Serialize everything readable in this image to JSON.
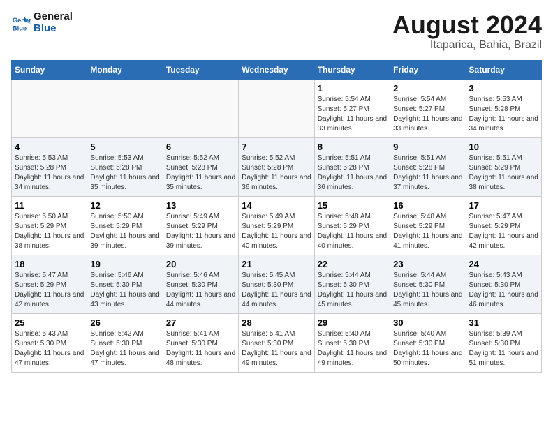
{
  "logo": {
    "text_general": "General",
    "text_blue": "Blue"
  },
  "title": "August 2024",
  "subtitle": "Itaparica, Bahia, Brazil",
  "days_of_week": [
    "Sunday",
    "Monday",
    "Tuesday",
    "Wednesday",
    "Thursday",
    "Friday",
    "Saturday"
  ],
  "weeks": [
    [
      {
        "day": "",
        "info": ""
      },
      {
        "day": "",
        "info": ""
      },
      {
        "day": "",
        "info": ""
      },
      {
        "day": "",
        "info": ""
      },
      {
        "day": "1",
        "info": "Sunrise: 5:54 AM\nSunset: 5:27 PM\nDaylight: 11 hours and 33 minutes."
      },
      {
        "day": "2",
        "info": "Sunrise: 5:54 AM\nSunset: 5:27 PM\nDaylight: 11 hours and 33 minutes."
      },
      {
        "day": "3",
        "info": "Sunrise: 5:53 AM\nSunset: 5:28 PM\nDaylight: 11 hours and 34 minutes."
      }
    ],
    [
      {
        "day": "4",
        "info": "Sunrise: 5:53 AM\nSunset: 5:28 PM\nDaylight: 11 hours and 34 minutes."
      },
      {
        "day": "5",
        "info": "Sunrise: 5:53 AM\nSunset: 5:28 PM\nDaylight: 11 hours and 35 minutes."
      },
      {
        "day": "6",
        "info": "Sunrise: 5:52 AM\nSunset: 5:28 PM\nDaylight: 11 hours and 35 minutes."
      },
      {
        "day": "7",
        "info": "Sunrise: 5:52 AM\nSunset: 5:28 PM\nDaylight: 11 hours and 36 minutes."
      },
      {
        "day": "8",
        "info": "Sunrise: 5:51 AM\nSunset: 5:28 PM\nDaylight: 11 hours and 36 minutes."
      },
      {
        "day": "9",
        "info": "Sunrise: 5:51 AM\nSunset: 5:28 PM\nDaylight: 11 hours and 37 minutes."
      },
      {
        "day": "10",
        "info": "Sunrise: 5:51 AM\nSunset: 5:29 PM\nDaylight: 11 hours and 38 minutes."
      }
    ],
    [
      {
        "day": "11",
        "info": "Sunrise: 5:50 AM\nSunset: 5:29 PM\nDaylight: 11 hours and 38 minutes."
      },
      {
        "day": "12",
        "info": "Sunrise: 5:50 AM\nSunset: 5:29 PM\nDaylight: 11 hours and 39 minutes."
      },
      {
        "day": "13",
        "info": "Sunrise: 5:49 AM\nSunset: 5:29 PM\nDaylight: 11 hours and 39 minutes."
      },
      {
        "day": "14",
        "info": "Sunrise: 5:49 AM\nSunset: 5:29 PM\nDaylight: 11 hours and 40 minutes."
      },
      {
        "day": "15",
        "info": "Sunrise: 5:48 AM\nSunset: 5:29 PM\nDaylight: 11 hours and 40 minutes."
      },
      {
        "day": "16",
        "info": "Sunrise: 5:48 AM\nSunset: 5:29 PM\nDaylight: 11 hours and 41 minutes."
      },
      {
        "day": "17",
        "info": "Sunrise: 5:47 AM\nSunset: 5:29 PM\nDaylight: 11 hours and 42 minutes."
      }
    ],
    [
      {
        "day": "18",
        "info": "Sunrise: 5:47 AM\nSunset: 5:29 PM\nDaylight: 11 hours and 42 minutes."
      },
      {
        "day": "19",
        "info": "Sunrise: 5:46 AM\nSunset: 5:30 PM\nDaylight: 11 hours and 43 minutes."
      },
      {
        "day": "20",
        "info": "Sunrise: 5:46 AM\nSunset: 5:30 PM\nDaylight: 11 hours and 44 minutes."
      },
      {
        "day": "21",
        "info": "Sunrise: 5:45 AM\nSunset: 5:30 PM\nDaylight: 11 hours and 44 minutes."
      },
      {
        "day": "22",
        "info": "Sunrise: 5:44 AM\nSunset: 5:30 PM\nDaylight: 11 hours and 45 minutes."
      },
      {
        "day": "23",
        "info": "Sunrise: 5:44 AM\nSunset: 5:30 PM\nDaylight: 11 hours and 45 minutes."
      },
      {
        "day": "24",
        "info": "Sunrise: 5:43 AM\nSunset: 5:30 PM\nDaylight: 11 hours and 46 minutes."
      }
    ],
    [
      {
        "day": "25",
        "info": "Sunrise: 5:43 AM\nSunset: 5:30 PM\nDaylight: 11 hours and 47 minutes."
      },
      {
        "day": "26",
        "info": "Sunrise: 5:42 AM\nSunset: 5:30 PM\nDaylight: 11 hours and 47 minutes."
      },
      {
        "day": "27",
        "info": "Sunrise: 5:41 AM\nSunset: 5:30 PM\nDaylight: 11 hours and 48 minutes."
      },
      {
        "day": "28",
        "info": "Sunrise: 5:41 AM\nSunset: 5:30 PM\nDaylight: 11 hours and 49 minutes."
      },
      {
        "day": "29",
        "info": "Sunrise: 5:40 AM\nSunset: 5:30 PM\nDaylight: 11 hours and 49 minutes."
      },
      {
        "day": "30",
        "info": "Sunrise: 5:40 AM\nSunset: 5:30 PM\nDaylight: 11 hours and 50 minutes."
      },
      {
        "day": "31",
        "info": "Sunrise: 5:39 AM\nSunset: 5:30 PM\nDaylight: 11 hours and 51 minutes."
      }
    ]
  ]
}
